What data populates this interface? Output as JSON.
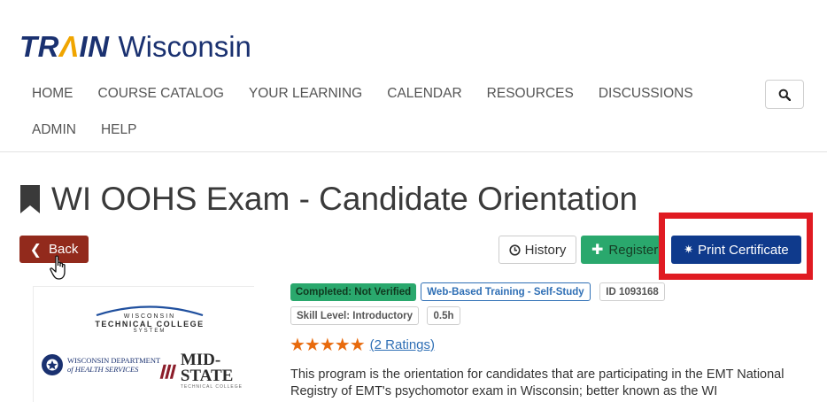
{
  "brand": {
    "train": "TRAIN",
    "state": "Wisconsin"
  },
  "nav": {
    "row1": [
      "HOME",
      "COURSE CATALOG",
      "YOUR LEARNING",
      "CALENDAR",
      "RESOURCES",
      "DISCUSSIONS"
    ],
    "row2": [
      "ADMIN",
      "HELP"
    ],
    "search_icon": "search-icon"
  },
  "course": {
    "title": "WI OOHS Exam - Candidate Orientation",
    "title_icon": "bookmark-icon"
  },
  "actions": {
    "back": "Back",
    "history": "History",
    "register": "Register",
    "print": "Print Certificate"
  },
  "logos": {
    "wtc_top": "WISCONSIN",
    "wtc_main": "TECHNICAL COLLEGE",
    "wtc_sub": "SYSTEM",
    "dhs_line1": "WISCONSIN DEPARTMENT",
    "dhs_line2": "of HEALTH SERVICES",
    "midstate_main": "MID-STATE",
    "midstate_sub": "TECHNICAL COLLEGE"
  },
  "tags": {
    "completed": "Completed: Not Verified",
    "type": "Web-Based Training - Self-Study",
    "id": "ID 1093168",
    "skill": "Skill Level: Introductory",
    "duration": "0.5h"
  },
  "rating": {
    "stars": "★★★★★",
    "value": 5,
    "link": "(2 Ratings)"
  },
  "description": "This program is the orientation for candidates that are participating in the EMT National Registry of EMT's psychomotor exam in Wisconsin; better known as the WI",
  "colors": {
    "brand_blue": "#1a3170",
    "back_red": "#922a1c",
    "register_green": "#2aa86d",
    "print_blue": "#0f3a8c",
    "highlight_red": "#e01b22",
    "star_orange": "#e86a0c"
  }
}
